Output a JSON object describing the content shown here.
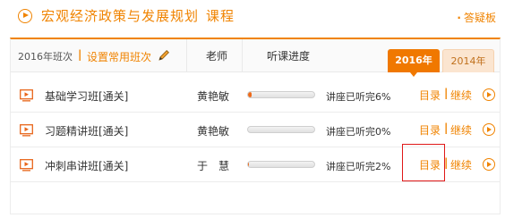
{
  "header": {
    "title": "宏观经济政策与发展规划",
    "title_suffix": "课程",
    "help_link": "答疑板",
    "icon": "play-circle-icon"
  },
  "colors": {
    "accent": "#f08300",
    "progress_fill": "#ee6a1a",
    "highlight_box": "#e01818"
  },
  "table_header": {
    "term_label": "2016年班次",
    "set_common_label": "设置常用班次",
    "teacher_label": "老师",
    "progress_label": "听课进度",
    "year_tabs": [
      {
        "label": "2016年",
        "active": true
      },
      {
        "label": "2014年",
        "active": false
      }
    ]
  },
  "rows": [
    {
      "course": "基础学习班[通关]",
      "teacher": "黄艳敏",
      "progress": 0.06,
      "status": "讲座已听完6%",
      "catalog": "目录",
      "continue": "继续"
    },
    {
      "course": "习题精讲班[通关]",
      "teacher": "黄艳敏",
      "progress": 0.0,
      "status": "讲座已听完0%",
      "catalog": "目录",
      "continue": "继续"
    },
    {
      "course": "冲刺串讲班[通关]",
      "teacher": "于　慧",
      "progress": 0.02,
      "status": "讲座已听完2%",
      "catalog": "目录",
      "continue": "继续"
    }
  ]
}
